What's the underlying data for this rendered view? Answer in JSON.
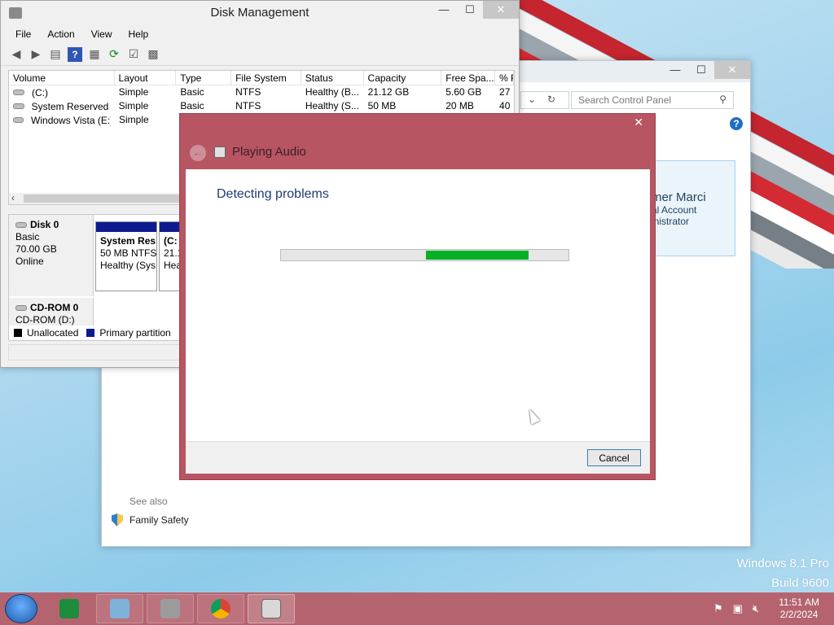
{
  "disk_management": {
    "title": "Disk Management",
    "menu": [
      "File",
      "Action",
      "View",
      "Help"
    ],
    "columns": [
      "Volume",
      "Layout",
      "Type",
      "File System",
      "Status",
      "Capacity",
      "Free Spa...",
      "% F"
    ],
    "rows": [
      [
        "(C:)",
        "Simple",
        "Basic",
        "NTFS",
        "Healthy (B...",
        "21.12 GB",
        "5.60 GB",
        "27"
      ],
      [
        "System Reserved",
        "Simple",
        "Basic",
        "NTFS",
        "Healthy (S...",
        "50 MB",
        "20 MB",
        "40"
      ],
      [
        "Windows Vista (E:)",
        "Simple",
        "",
        "",
        "",
        "",
        "",
        ""
      ]
    ],
    "disk0": {
      "name": "Disk 0",
      "type": "Basic",
      "size": "70.00 GB",
      "state": "Online"
    },
    "partition_system": {
      "name": "System Res",
      "size": "50 MB NTFS",
      "status": "Healthy (Sys"
    },
    "partition_c": {
      "name": "(C:",
      "size": "21.1",
      "status": "Hea"
    },
    "cdrom": {
      "name": "CD-ROM 0",
      "drive": "CD-ROM (D:)"
    },
    "legend": {
      "unallocated": "Unallocated",
      "primary": "Primary partition"
    }
  },
  "control_panel": {
    "search_placeholder": "Search Control Panel",
    "user_name": "mer Marci",
    "user_line1": "al Account",
    "user_line2": "inistrator",
    "see_also": "See also",
    "family_safety": "Family Safety"
  },
  "troubleshooter": {
    "title": "Playing Audio",
    "heading": "Detecting problems",
    "cancel_label": "Cancel",
    "progress_start": 0.505,
    "progress_end": 0.86
  },
  "desktop": {
    "os_name": "Windows 8.1 Pro",
    "build": "Build 9600"
  },
  "taskbar": {
    "time": "11:51 AM",
    "date": "2/2/2024"
  },
  "colors": {
    "accent_dialog": "#b85563",
    "progress_fill": "#06b025",
    "partition_bar": "#0d1a8f"
  }
}
